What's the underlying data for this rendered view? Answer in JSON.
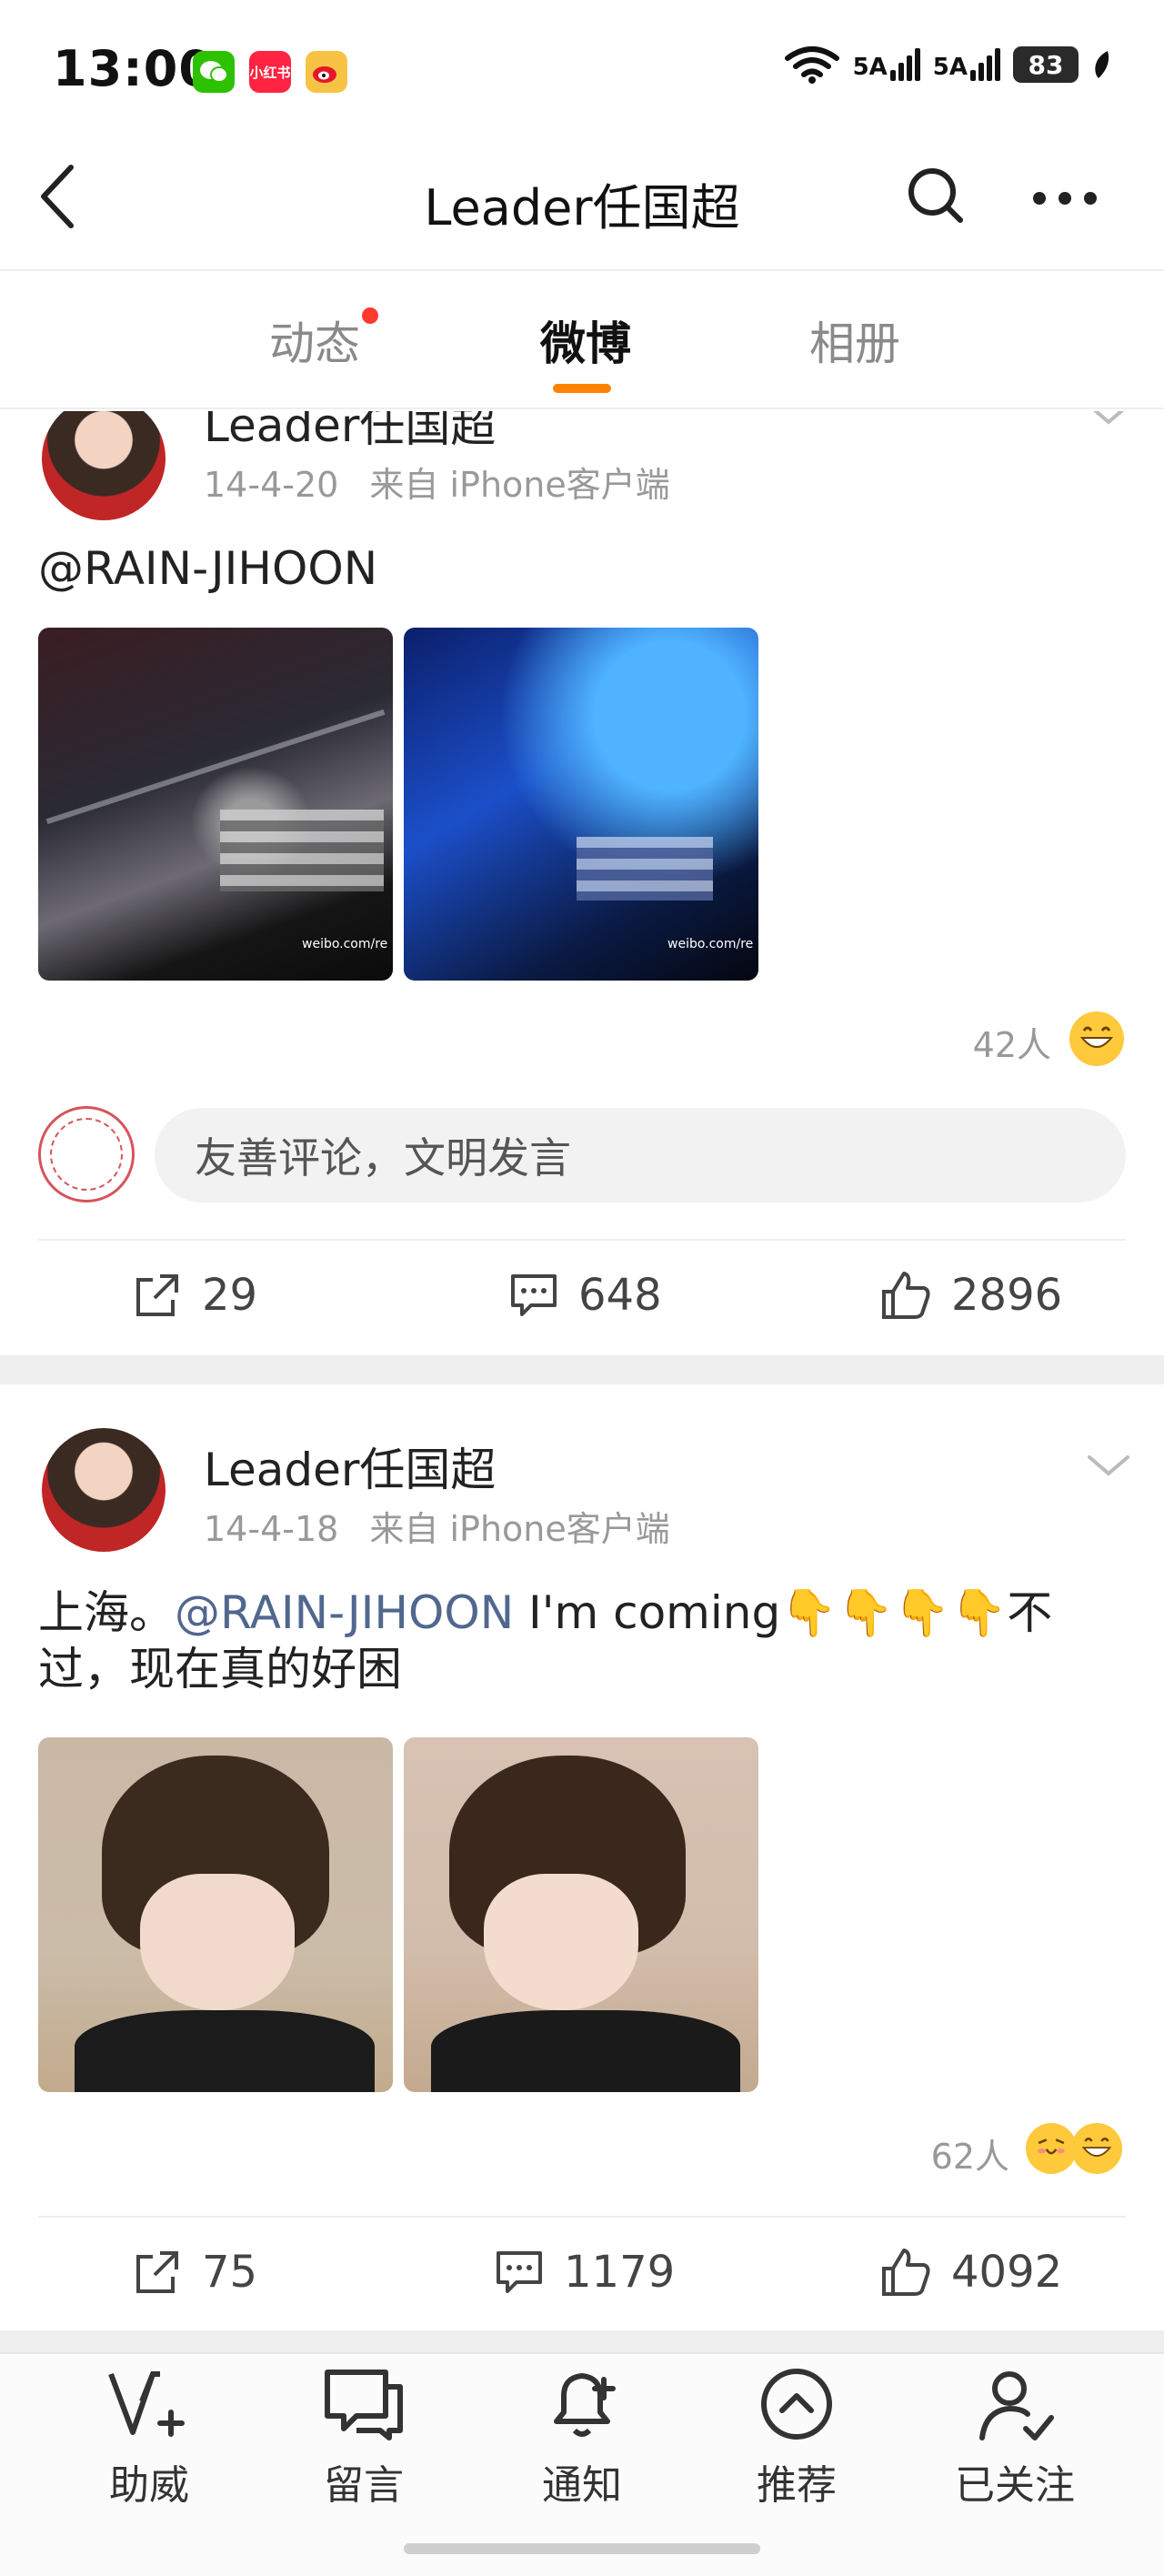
{
  "status_bar": {
    "time": "13:00",
    "app_icons": [
      {
        "name": "wechat",
        "label": "",
        "color": "#2dc100"
      },
      {
        "name": "xiaohongshu",
        "label": "小红书",
        "color": "#ff2442"
      },
      {
        "name": "weibo",
        "label": "",
        "color": "#f7c344"
      }
    ],
    "signal1": "5A",
    "signal2": "5A",
    "battery": "83"
  },
  "header": {
    "title": "Leader任国超"
  },
  "tabs": [
    {
      "label": "动态",
      "dot": true
    },
    {
      "label": "微博",
      "active": true
    },
    {
      "label": "相册"
    }
  ],
  "posts": [
    {
      "author": "Leader任国超",
      "date": "14-4-20",
      "source": "来自 iPhone客户端",
      "text_mention": "@RAIN-JIHOON",
      "reactions_count": "42人",
      "comment_placeholder": "友善评论，文明发言",
      "reposts": "29",
      "comments": "648",
      "likes": "2896"
    },
    {
      "author": "Leader任国超",
      "date": "14-4-18",
      "source": "来自 iPhone客户端",
      "text_prefix": "上海。",
      "text_mention": "@RAIN-JIHOON",
      "text_rest": " I'm coming👇👇👇👇不",
      "text_line2": "过，现在真的好困",
      "reactions_count": "62人",
      "reposts": "75",
      "comments": "1179",
      "likes": "4092"
    }
  ],
  "bottom_nav": [
    {
      "label": "助威",
      "icon": "cheer-icon"
    },
    {
      "label": "留言",
      "icon": "message-icon"
    },
    {
      "label": "通知",
      "icon": "bell-plus-icon"
    },
    {
      "label": "推荐",
      "icon": "recommend-icon"
    },
    {
      "label": "已关注",
      "icon": "followed-user-icon"
    }
  ],
  "colors": {
    "accent_orange": "#ff8200",
    "mention_blue": "#51678f",
    "notification_red": "#ff3b30"
  }
}
